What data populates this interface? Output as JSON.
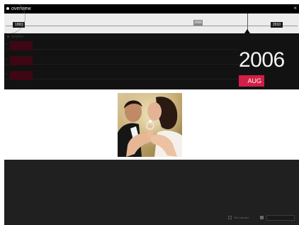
{
  "overview": {
    "title": "overview",
    "close_label": "×",
    "timeline": {
      "start_year": "1993",
      "end_year": "2010",
      "current_marker": "2006"
    },
    "sub_title": "timeline",
    "track_rows": 3
  },
  "display": {
    "year": "2006",
    "month": "AUG"
  },
  "bottom": {
    "checkbox_label": "File transfer"
  },
  "colors": {
    "accent": "#d21f45",
    "panel_dark": "#0c0c0c",
    "bottom_panel": "#202020",
    "row_bar": "#3e0713"
  }
}
